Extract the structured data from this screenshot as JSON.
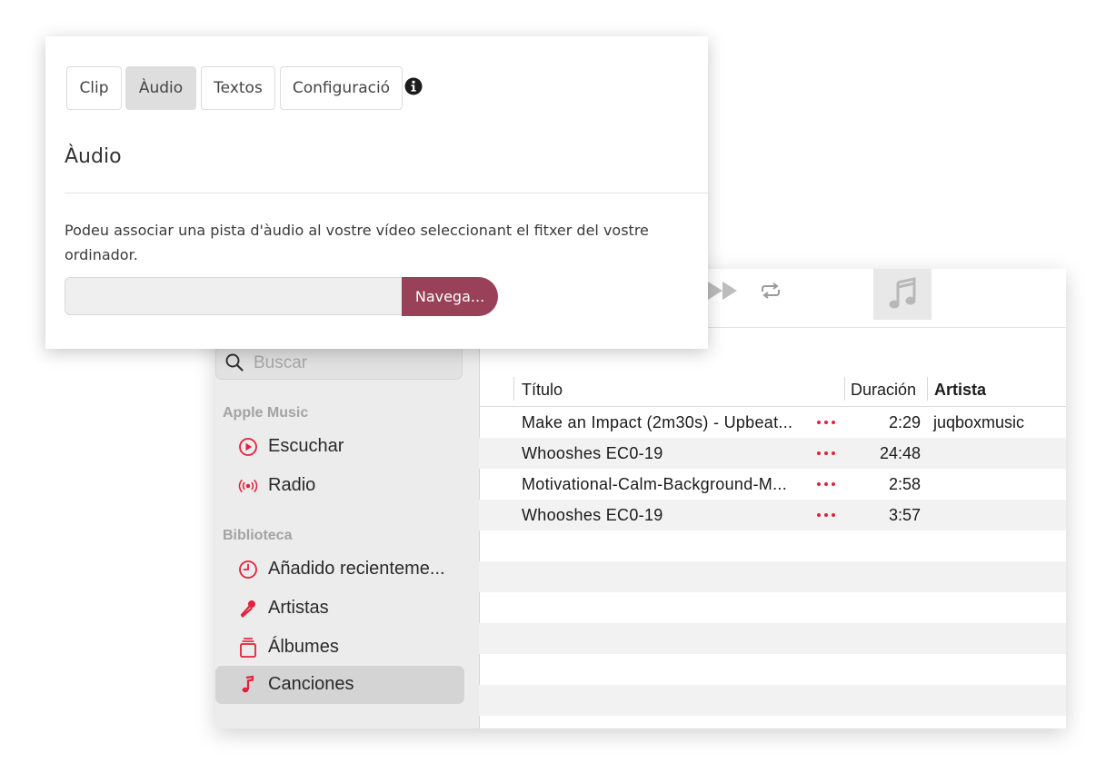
{
  "panel": {
    "tabs": [
      {
        "label": "Clip"
      },
      {
        "label": "Àudio"
      },
      {
        "label": "Textos"
      },
      {
        "label": "Configuració"
      }
    ],
    "heading": "Àudio",
    "description": "Podeu associar una pista d'àudio al vostre vídeo seleccionant el fitxer del vostre ordinador.",
    "file_input_value": "",
    "browse_label": "Navega...",
    "accent_color": "#994158"
  },
  "music": {
    "search_placeholder": "Buscar",
    "sections": [
      {
        "heading": "Apple Music",
        "items": [
          {
            "label": "Escuchar",
            "icon": "play-circle-icon"
          },
          {
            "label": "Radio",
            "icon": "radio-waves-icon"
          }
        ]
      },
      {
        "heading": "Biblioteca",
        "items": [
          {
            "label": "Añadido recienteme...",
            "icon": "clock-icon"
          },
          {
            "label": "Artistas",
            "icon": "microphone-icon"
          },
          {
            "label": "Álbumes",
            "icon": "albums-icon"
          },
          {
            "label": "Canciones",
            "icon": "music-note-icon",
            "selected": true
          }
        ]
      }
    ],
    "columns": {
      "title": "Título",
      "duration": "Duración",
      "artist": "Artista"
    },
    "songs": [
      {
        "title": "Make an Impact (2m30s) - Upbeat...",
        "duration": "2:29",
        "artist": "juqboxmusic"
      },
      {
        "title": "Whooshes EC0-19",
        "duration": "24:48",
        "artist": ""
      },
      {
        "title": "Motivational-Calm-Background-M...",
        "duration": "2:58",
        "artist": ""
      },
      {
        "title": "Whooshes EC0-19",
        "duration": "3:57",
        "artist": ""
      }
    ],
    "accent_color": "#e4203c"
  }
}
